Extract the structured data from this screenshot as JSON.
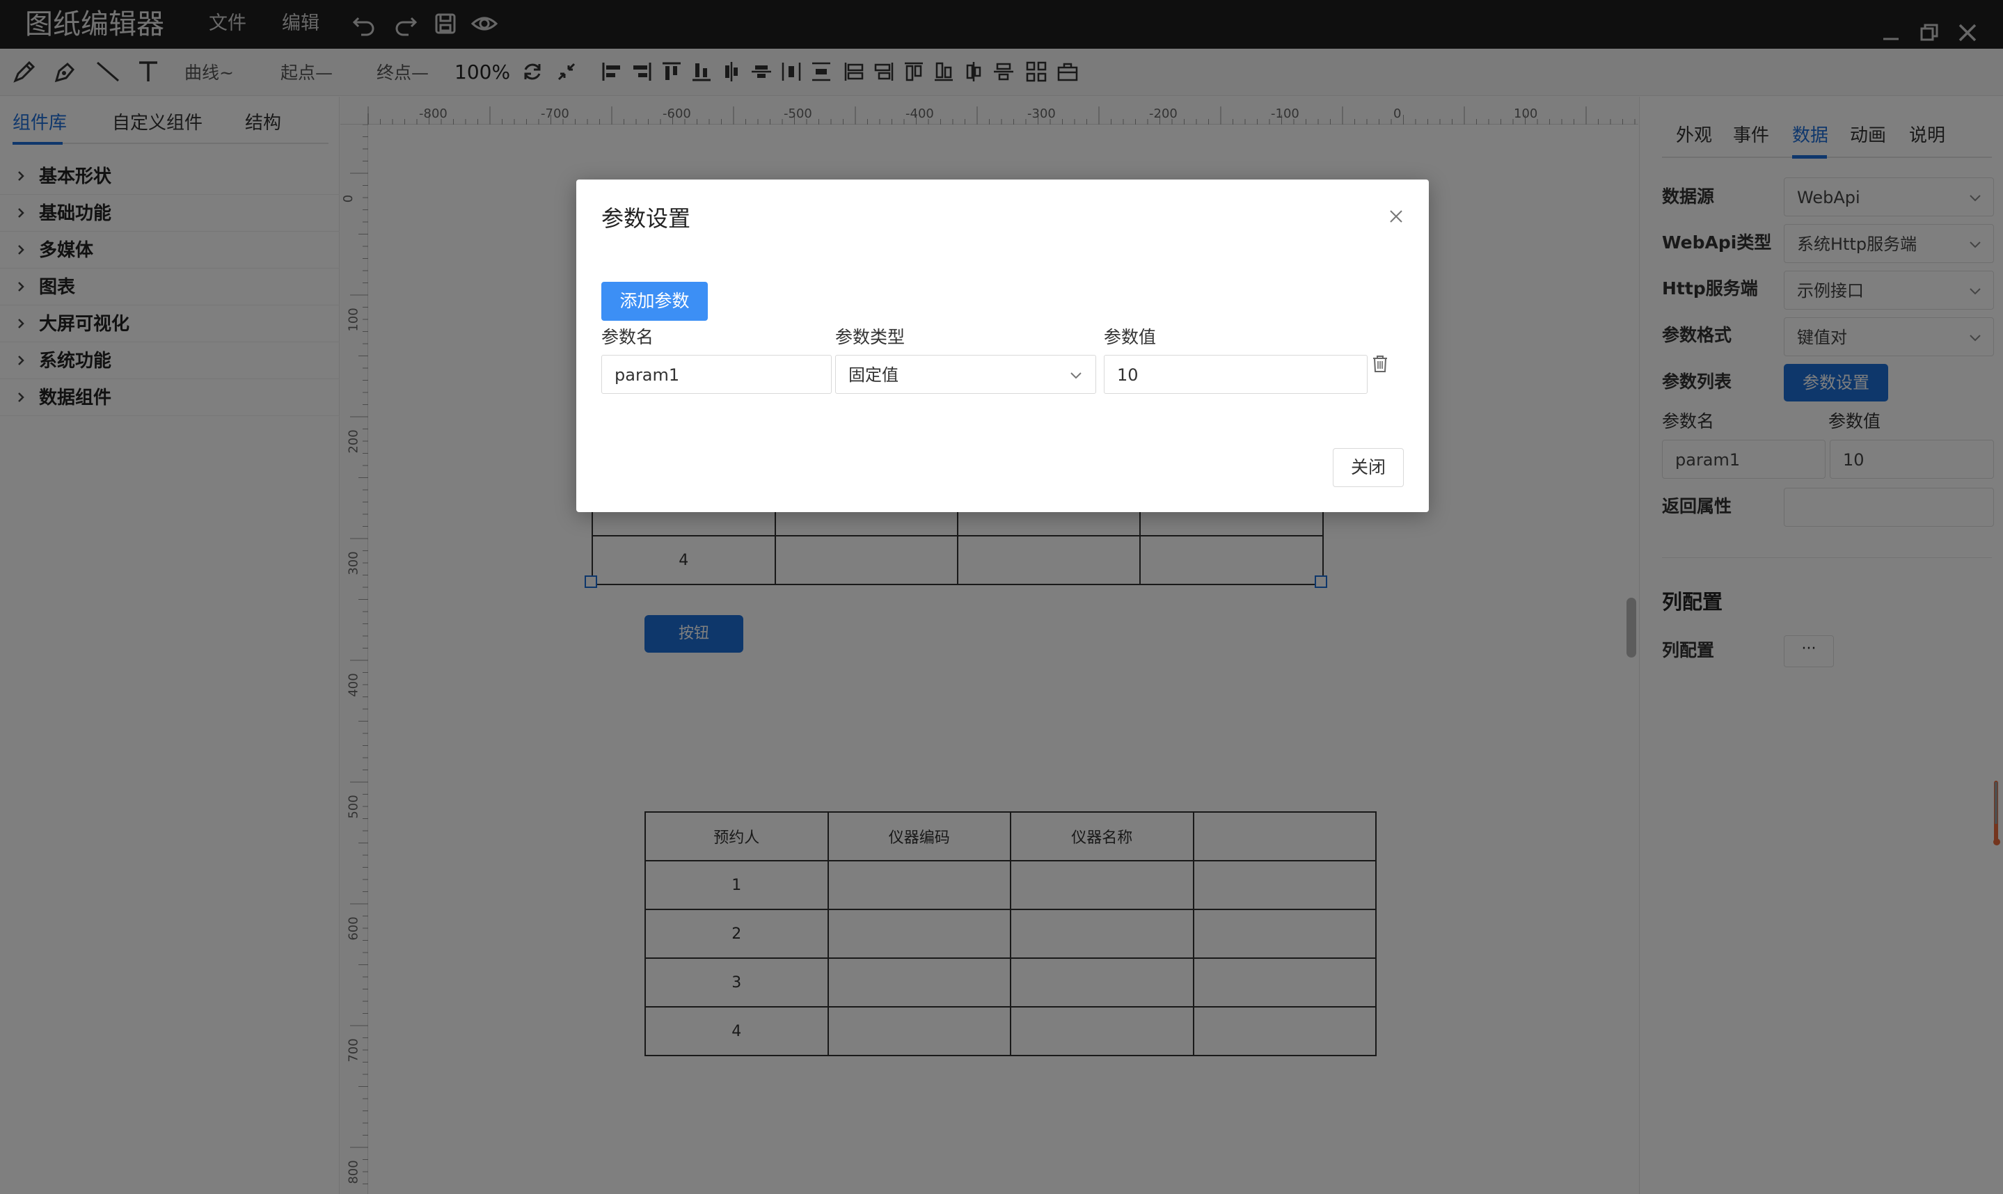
{
  "app": {
    "title": "图纸编辑器",
    "menu": [
      "文件",
      "编辑"
    ]
  },
  "toolbar": {
    "curve_label": "曲线~",
    "start_label": "起点—",
    "end_label": "终点—",
    "zoom": "100%"
  },
  "left_panel": {
    "tabs": [
      {
        "label": "组件库",
        "active": true
      },
      {
        "label": "自定义组件",
        "active": false
      },
      {
        "label": "结构",
        "active": false
      }
    ],
    "tree": [
      "基本形状",
      "基础功能",
      "多媒体",
      "图表",
      "大屏可视化",
      "系统功能",
      "数据组件"
    ]
  },
  "canvas": {
    "ruler_x": [
      "-800",
      "-700",
      "-600",
      "-500",
      "-400",
      "-300",
      "-200",
      "-100",
      "0",
      "100"
    ],
    "ruler_y": [
      "0",
      "100",
      "200",
      "300",
      "400",
      "500",
      "600",
      "700",
      "800"
    ],
    "button_label": "按钮",
    "table_upper_visible_row": "4",
    "table_lower": {
      "headers": [
        "预约人",
        "仪器编码",
        "仪器名称",
        ""
      ],
      "rows": [
        "1",
        "2",
        "3",
        "4"
      ]
    }
  },
  "right_panel": {
    "tabs": [
      {
        "label": "外观",
        "active": false
      },
      {
        "label": "事件",
        "active": false
      },
      {
        "label": "数据",
        "active": true
      },
      {
        "label": "动画",
        "active": false
      },
      {
        "label": "说明",
        "active": false
      }
    ],
    "datasource_label": "数据源",
    "datasource_value": "WebApi",
    "webapi_type_label": "WebApi类型",
    "webapi_type_value": "系统Http服务端",
    "http_server_label": "Http服务端",
    "http_server_value": "示例接口",
    "param_format_label": "参数格式",
    "param_format_value": "键值对",
    "param_list_label": "参数列表",
    "param_settings_button": "参数设置",
    "param_name_header": "参数名",
    "param_value_header": "参数值",
    "param_name_value": "param1",
    "param_value_value": "10",
    "return_attr_label": "返回属性",
    "return_attr_value": "",
    "column_config_section": "列配置",
    "column_config_label": "列配置",
    "column_config_button": "···"
  },
  "dialog": {
    "title": "参数设置",
    "add_button": "添加参数",
    "headers": [
      "参数名",
      "参数类型",
      "参数值"
    ],
    "param": {
      "name": "param1",
      "type": "固定值",
      "value": "10"
    },
    "close_button": "关闭"
  },
  "colors": {
    "accent": "#1d6fd6",
    "add_button": "#3c8ff5",
    "titlebar": "#1f1f1f"
  }
}
